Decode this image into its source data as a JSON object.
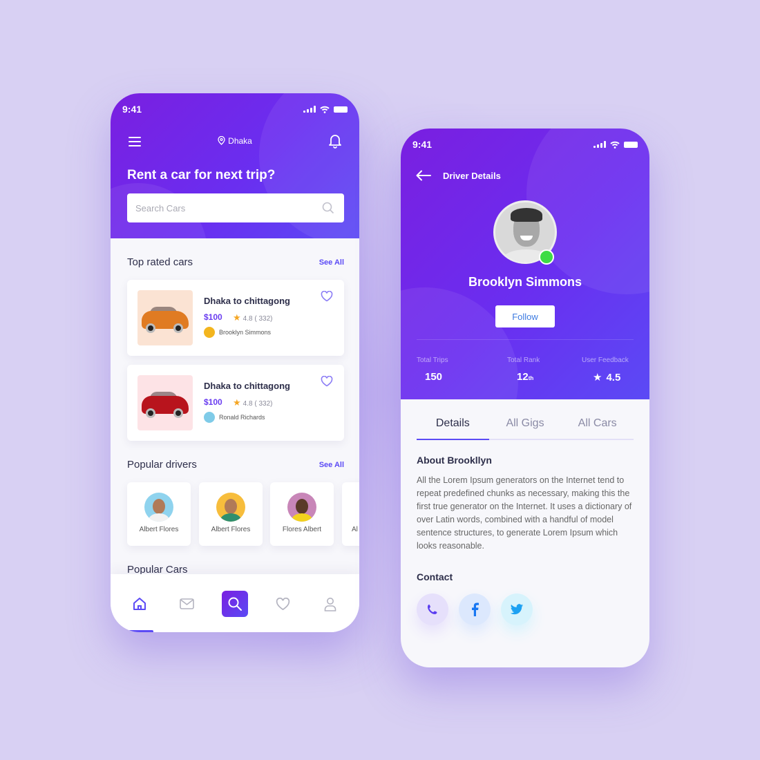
{
  "phone1": {
    "status_time": "9:41",
    "location": "Dhaka",
    "hero_title": "Rent a car for next trip?",
    "search": {
      "placeholder": "Search Cars",
      "value": ""
    },
    "top_rated": {
      "title": "Top rated cars",
      "see_all": "See All",
      "cars": [
        {
          "title": "Dhaka to chittagong",
          "price": "$100",
          "rating": "4.8 ( 332)",
          "owner": "Brooklyn Simmons",
          "car_color": "#e07b22",
          "thumb_bg": "#fbe3d3",
          "avatar_bg": "#f3b51e"
        },
        {
          "title": "Dhaka to chittagong",
          "price": "$100",
          "rating": "4.8 ( 332)",
          "owner": "Ronald Richards",
          "car_color": "#b8141d",
          "thumb_bg": "#fde3e6",
          "avatar_bg": "#7fcbe8"
        }
      ]
    },
    "popular_drivers": {
      "title": "Popular drivers",
      "see_all": "See All",
      "drivers": [
        {
          "name": "Albert Flores",
          "avatar_bg": "#8fd3ee",
          "shirt": "#f2f2f2"
        },
        {
          "name": "Albert Flores",
          "avatar_bg": "#f7bd3c",
          "shirt": "#2f8f6e"
        },
        {
          "name": "Flores Albert",
          "avatar_bg": "#c886b8",
          "shirt": "#f2d21e"
        },
        {
          "name": "Al",
          "avatar_bg": "#cccccc",
          "shirt": "#eeeeee"
        }
      ]
    },
    "popular_cars": {
      "title": "Popular Cars"
    },
    "nav": [
      "home",
      "messages",
      "search",
      "favorites",
      "profile"
    ]
  },
  "phone2": {
    "status_time": "9:41",
    "title": "Driver Details",
    "name": "Brooklyn Simmons",
    "online": true,
    "follow_label": "Follow",
    "stats": [
      {
        "label": "Total Trips",
        "value": "150",
        "suffix": ""
      },
      {
        "label": "Total Rank",
        "value": "12",
        "suffix": "th"
      },
      {
        "label": "User Feedback",
        "value": "4.5",
        "suffix": ""
      }
    ],
    "tabs": [
      "Details",
      "All Gigs",
      "All Cars"
    ],
    "active_tab": "Details",
    "about_title": "About Brookllyn",
    "about_text": "All the Lorem Ipsum generators on the Internet tend to repeat predefined chunks as necessary, making this the first true generator on the Internet. It uses a dictionary of over Latin words, combined with a handful of model sentence structures, to generate Lorem Ipsum which looks reasonable.",
    "contact_title": "Contact",
    "contacts": [
      {
        "type": "phone",
        "bg": "#e6e0fb",
        "color": "#5b3ef0"
      },
      {
        "type": "facebook",
        "bg": "#dce8fd",
        "color": "#1877f2"
      },
      {
        "type": "twitter",
        "bg": "#d7f3fc",
        "color": "#1da1f2"
      }
    ]
  },
  "colors": {
    "accent": "#5b4af5",
    "hero_start": "#7a1fe0",
    "hero_end": "#5b4af5",
    "text_dark": "#2d2e4a",
    "online": "#3ddc45",
    "star": "#f5a623"
  }
}
